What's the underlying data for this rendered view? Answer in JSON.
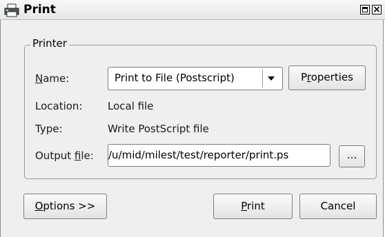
{
  "window": {
    "title": "Print"
  },
  "printer_group": {
    "title": "Printer",
    "name_label": "Name:",
    "name_value": "Print to File (Postscript)",
    "properties_label": "Properties",
    "location_label": "Location:",
    "location_value": "Local file",
    "type_label": "Type:",
    "type_value": "Write PostScript file",
    "output_label": "Output file:",
    "output_value": "/u/mid/milest/test/reporter/print.ps",
    "browse_label": "..."
  },
  "buttons": {
    "options_label": "Options >>",
    "print_label": "Print",
    "cancel_label": "Cancel"
  },
  "icons": {
    "window_icon": "printer-icon",
    "dropdown": "chevron-down-icon",
    "maximize": "maximize-icon",
    "close": "close-icon"
  }
}
